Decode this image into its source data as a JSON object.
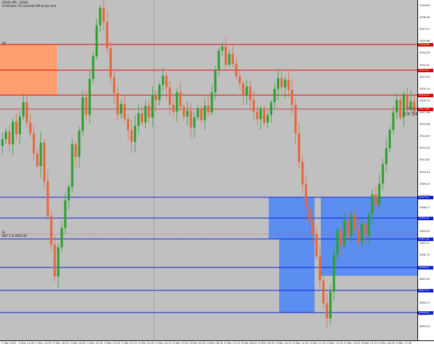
{
  "header": {
    "symbol_line": "GOLD, M5 : GOLD",
    "timer_line": "0 minutes 7H seconds left to bar end"
  },
  "price_labels": {
    "sl_label": "SL",
    "buy_label": "BUY 7 at 2902.38",
    "tp_label": "TP",
    "spread_label": "<3.54",
    "order_tag": "176.6 m"
  },
  "levels": {
    "red_lines": [
      "2924.46",
      "2921.82",
      "2919.05",
      "2917.96"
    ],
    "blue_lines": [
      "2907.37",
      "2904.94",
      "2902.28",
      "2899.62",
      "2897.13",
      "2894.63"
    ],
    "current": "2918.05"
  },
  "y_ticks": [
    "2929.84",
    "2928.46",
    "2927.07",
    "2925.68",
    "2924.30",
    "2922.91",
    "2921.52",
    "2920.14",
    "2918.75",
    "2917.36",
    "2915.98",
    "2914.59",
    "2913.20",
    "2911.82",
    "2910.43",
    "2909.04",
    "2907.66",
    "2906.27",
    "2904.88",
    "2903.49",
    "2902.11",
    "2900.72",
    "2899.33",
    "2897.95",
    "2896.56",
    "2895.17",
    "2893.79",
    "2892.40"
  ],
  "x_ticks": [
    "5 Mar 2025",
    "5 Mar 14:45",
    "5 Mar 15:25",
    "5 Mar 16:05",
    "5 Mar 16:45",
    "5 Mar 19:25",
    "5 Mar 20:05",
    "5 Mar 22:25",
    "5 Mar 23:05",
    "6 Mar 02:25",
    "6 Mar 03:05",
    "6 Mar 04:05",
    "6 Mar 06:45",
    "6 Mar 07:25",
    "6 Mar 08:05",
    "6 Mar 09:05",
    "6 Mar 10:25",
    "6 Mar 11:05",
    "6 Mar 12:25",
    "6 Mar 13:05",
    "6 Mar 14:45",
    "6 Mar 15:25",
    "6 Mar 16:05",
    "6 Mar 17:05"
  ],
  "colors": {
    "bull": "#2ca02c",
    "bear": "#e8663a",
    "supply_zone": "#ff9e6e",
    "demand_zone": "#5b8ef0",
    "red_line": "#e00000",
    "blue_line": "#0a1ed8"
  },
  "chart_data": {
    "type": "candlestick",
    "closes": [
      2914.2,
      2915.1,
      2913.6,
      2916.3,
      2914.8,
      2916.9,
      2918.6,
      2916.2,
      2914.9,
      2912.5,
      2911.0,
      2913.8,
      2909.2,
      2905.0,
      2901.6,
      2897.8,
      2901.3,
      2903.6,
      2906.9,
      2908.5,
      2913.6,
      2912.1,
      2915.2,
      2919.2,
      2917.1,
      2921.4,
      2924.1,
      2927.8,
      2929.9,
      2928.2,
      2925.1,
      2921.6,
      2919.7,
      2917.2,
      2918.4,
      2916.6,
      2915.3,
      2913.9,
      2915.8,
      2917.3,
      2916.2,
      2918.2,
      2916.8,
      2919.5,
      2918.9,
      2920.7,
      2921.8,
      2920.4,
      2918.3,
      2917.5,
      2919.8,
      2918.1,
      2916.9,
      2917.6,
      2915.6,
      2916.8,
      2917.9,
      2916.5,
      2918.2,
      2917.4,
      2919.8,
      2922.4,
      2924.8,
      2925.3,
      2923.1,
      2924.4,
      2923.2,
      2921.7,
      2920.9,
      2919.4,
      2920.5,
      2918.9,
      2917.5,
      2916.6,
      2917.8,
      2916.2,
      2917.1,
      2918.6,
      2920.2,
      2921.5,
      2920.4,
      2921.3,
      2920.1,
      2918.3,
      2914.9,
      2911.5,
      2908.8,
      2906.1,
      2904.3,
      2902.9,
      2900.2,
      2897.3,
      2894.6,
      2892.8,
      2896.0,
      2900.4,
      2903.3,
      2901.5,
      2904.5,
      2902.6,
      2905.2,
      2903.4,
      2901.9,
      2904.1,
      2902.7,
      2905.2,
      2907.6,
      2906.3,
      2908.9,
      2911.2,
      2913.1,
      2915.3,
      2917.4,
      2918.9,
      2916.8,
      2919.6,
      2917.9,
      2918.7,
      2917.5
    ]
  }
}
